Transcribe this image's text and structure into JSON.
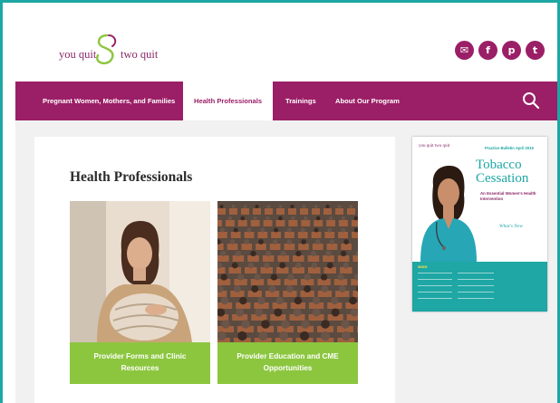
{
  "brand": {
    "logo_left": "you quit",
    "logo_right": "two quit",
    "accent": "#9b1f66",
    "teal": "#1ea7a4",
    "green": "#8cc63f"
  },
  "socials": [
    {
      "icon": "mail-icon",
      "glyph": "✉"
    },
    {
      "icon": "facebook-icon",
      "glyph": "f"
    },
    {
      "icon": "pinterest-icon",
      "glyph": "p"
    },
    {
      "icon": "twitter-icon",
      "glyph": "t"
    }
  ],
  "nav": {
    "items": [
      {
        "label": "Pregnant Women, Mothers, and Families"
      },
      {
        "label": "Health Professionals",
        "active": true
      },
      {
        "label": "Trainings"
      },
      {
        "label": "About Our Program"
      }
    ],
    "search_icon": "search-icon"
  },
  "main": {
    "title": "Health Professionals",
    "tiles": [
      {
        "caption": "Provider Forms and Clinic Resources"
      },
      {
        "caption": "Provider Education and CME Opportunities"
      }
    ]
  },
  "bulletin": {
    "logo": "you quit two quit",
    "practice": "Practice Bulletin  April 2019",
    "title_line1": "Tobacco",
    "title_line2": "Cessation",
    "subtitle": "An Essential Women's Health Intervention",
    "whats_new": "What's New",
    "inside": "INSIDE"
  }
}
